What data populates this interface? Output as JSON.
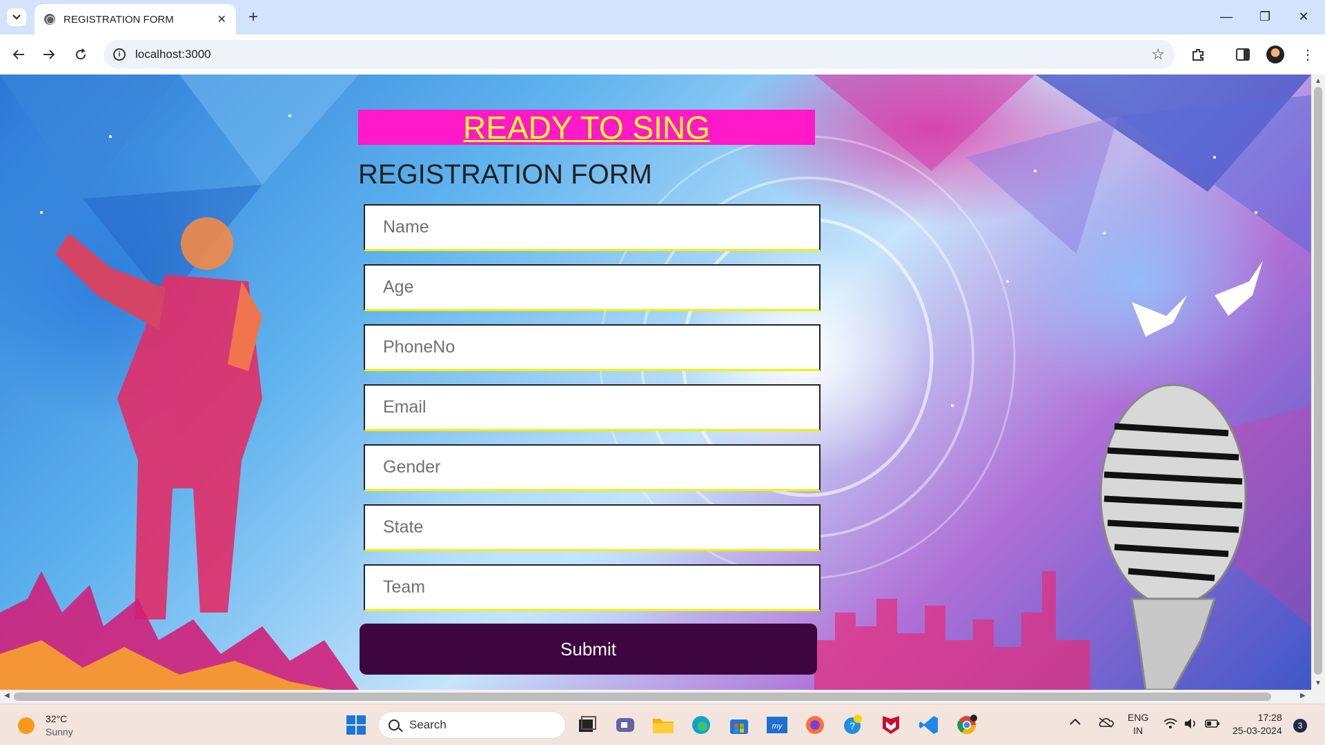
{
  "browser": {
    "tab_title": "REGISTRATION FORM",
    "tab_close": "✕",
    "new_tab": "+",
    "url": "localhost:3000",
    "window_controls": {
      "minimize": "—",
      "restore": "❐",
      "close": "✕"
    }
  },
  "page": {
    "banner": "READY TO SING",
    "title": "REGISTRATION FORM",
    "fields": [
      {
        "placeholder": "Name",
        "value": ""
      },
      {
        "placeholder": "Age",
        "value": ""
      },
      {
        "placeholder": "PhoneNo",
        "value": ""
      },
      {
        "placeholder": "Email",
        "value": ""
      },
      {
        "placeholder": "Gender",
        "value": ""
      },
      {
        "placeholder": "State",
        "value": ""
      },
      {
        "placeholder": "Team",
        "value": ""
      }
    ],
    "submit_label": "Submit",
    "colors": {
      "banner_bg": "#ff19c9",
      "banner_text": "#ffff33",
      "submit_bg": "#3d0640",
      "field_underline": "#f2f205"
    }
  },
  "taskbar": {
    "weather_temp": "32°C",
    "weather_desc": "Sunny",
    "search_label": "Search",
    "language": "ENG",
    "region": "IN",
    "time": "17:28",
    "date": "25-03-2024",
    "notifications": "3",
    "apps": [
      "windows-start-icon",
      "task-view-icon",
      "teams-icon",
      "file-explorer-icon",
      "edge-icon",
      "store-icon",
      "hp-icon",
      "firefox-icon",
      "help-icon",
      "mcafee-icon",
      "vscode-icon",
      "chrome-icon"
    ]
  }
}
